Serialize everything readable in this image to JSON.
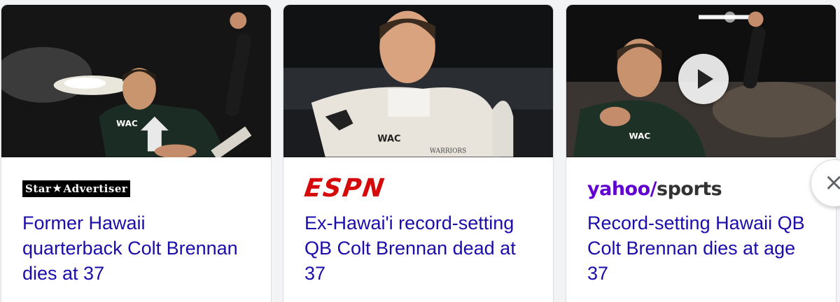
{
  "cards": [
    {
      "source": "Star Advertiser",
      "logo_parts": [
        "Star",
        "★",
        "Advertiser"
      ],
      "headline": "Former Hawaii quarterback Colt Brennan dies at 37",
      "has_video": false
    },
    {
      "source": "ESPN",
      "logo_text": "ESPN",
      "headline": "Ex-Hawai'i record-setting QB Colt Brennan dead at 37",
      "has_video": false
    },
    {
      "source": "yahoo/sports",
      "logo_parts": [
        "yahoo",
        "/",
        "sports"
      ],
      "headline": "Record-setting Hawaii QB Colt Brennan dies at age 37",
      "has_video": true
    }
  ],
  "jersey_texts": [
    "WAC",
    "WAC",
    "WARRIORS",
    "WAC"
  ],
  "navigation": {
    "next_icon": "×"
  },
  "colors": {
    "headline": "#1a0dab",
    "espn_red": "#d50a0a",
    "yahoo_purple": "#6001d2"
  }
}
